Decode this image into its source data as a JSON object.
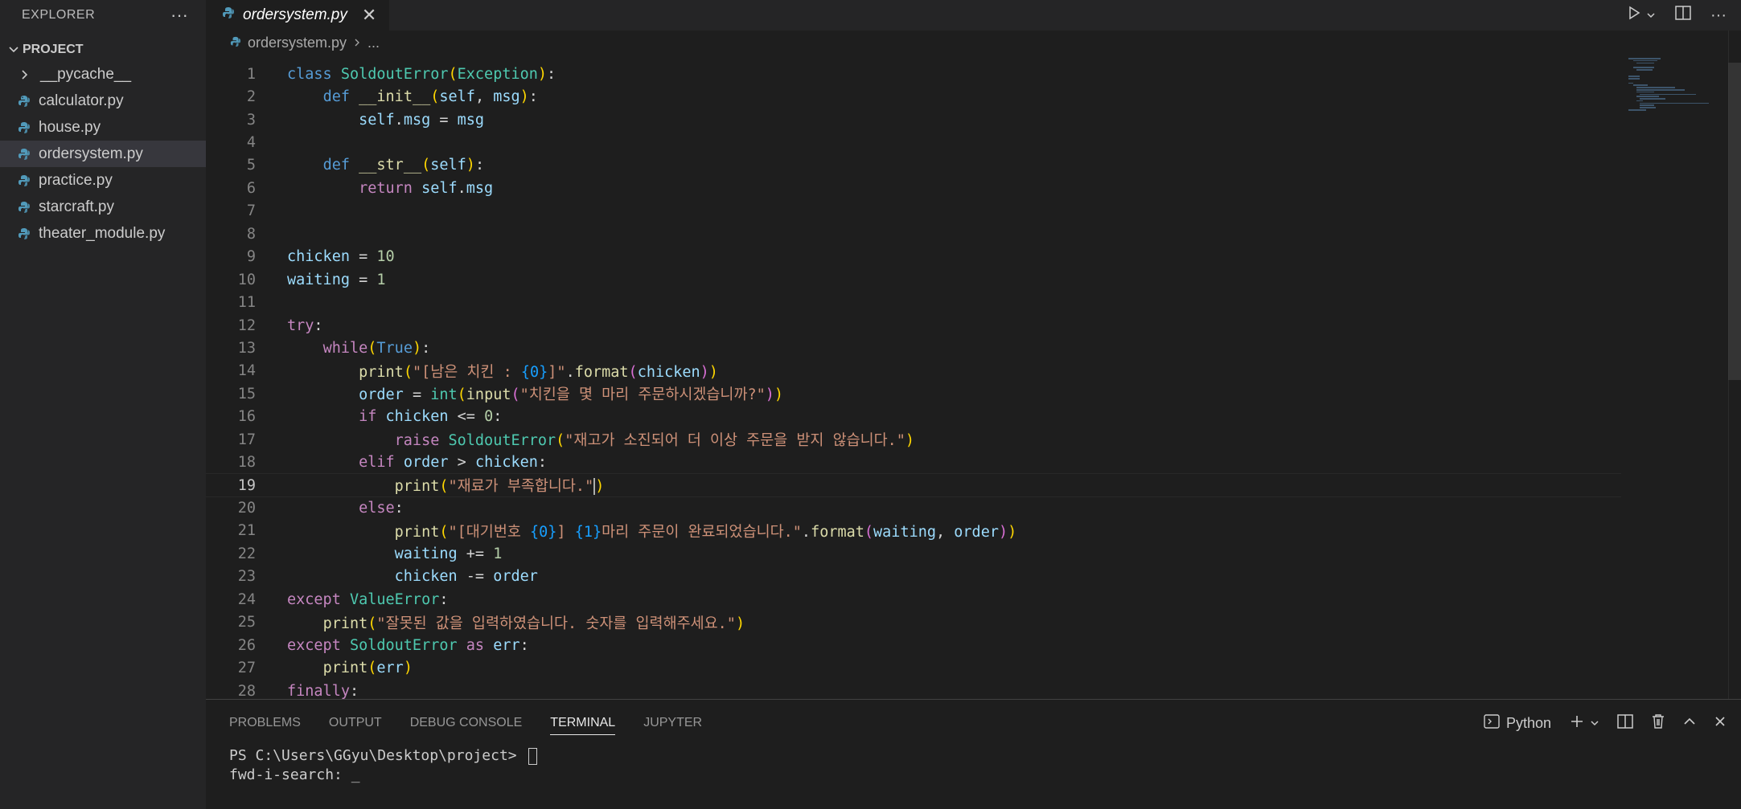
{
  "sidebar": {
    "title": "EXPLORER",
    "more_label": "···",
    "project_label": "PROJECT",
    "items": [
      {
        "label": "__pycache__",
        "type": "folder"
      },
      {
        "label": "calculator.py",
        "type": "file"
      },
      {
        "label": "house.py",
        "type": "file"
      },
      {
        "label": "ordersystem.py",
        "type": "file",
        "active": true
      },
      {
        "label": "practice.py",
        "type": "file"
      },
      {
        "label": "starcraft.py",
        "type": "file"
      },
      {
        "label": "theater_module.py",
        "type": "file"
      }
    ]
  },
  "tabs": [
    {
      "label": "ordersystem.py",
      "active": true
    }
  ],
  "breadcrumb": {
    "file": "ordersystem.py",
    "rest": "..."
  },
  "editor": {
    "current_line": 19,
    "line_numbers": [
      "1",
      "2",
      "3",
      "4",
      "5",
      "6",
      "7",
      "8",
      "9",
      "10",
      "11",
      "12",
      "13",
      "14",
      "15",
      "16",
      "17",
      "18",
      "19",
      "20",
      "21",
      "22",
      "23",
      "24",
      "25",
      "26",
      "27",
      "28"
    ]
  },
  "panel": {
    "tabs": [
      "PROBLEMS",
      "OUTPUT",
      "DEBUG CONSOLE",
      "TERMINAL",
      "JUPYTER"
    ],
    "active_tab": "TERMINAL",
    "terminal_profile": "Python",
    "terminal_lines": [
      "PS C:\\Users\\GGyu\\Desktop\\project> ",
      "fwd-i-search: _"
    ]
  },
  "colors": {
    "keyword": "#569cd6",
    "control": "#c586c0",
    "class": "#4ec9b0",
    "function": "#dcdcaa",
    "variable": "#9cdcfe",
    "string": "#ce9178",
    "number": "#b5cea8",
    "python_icon": "#519aba"
  }
}
